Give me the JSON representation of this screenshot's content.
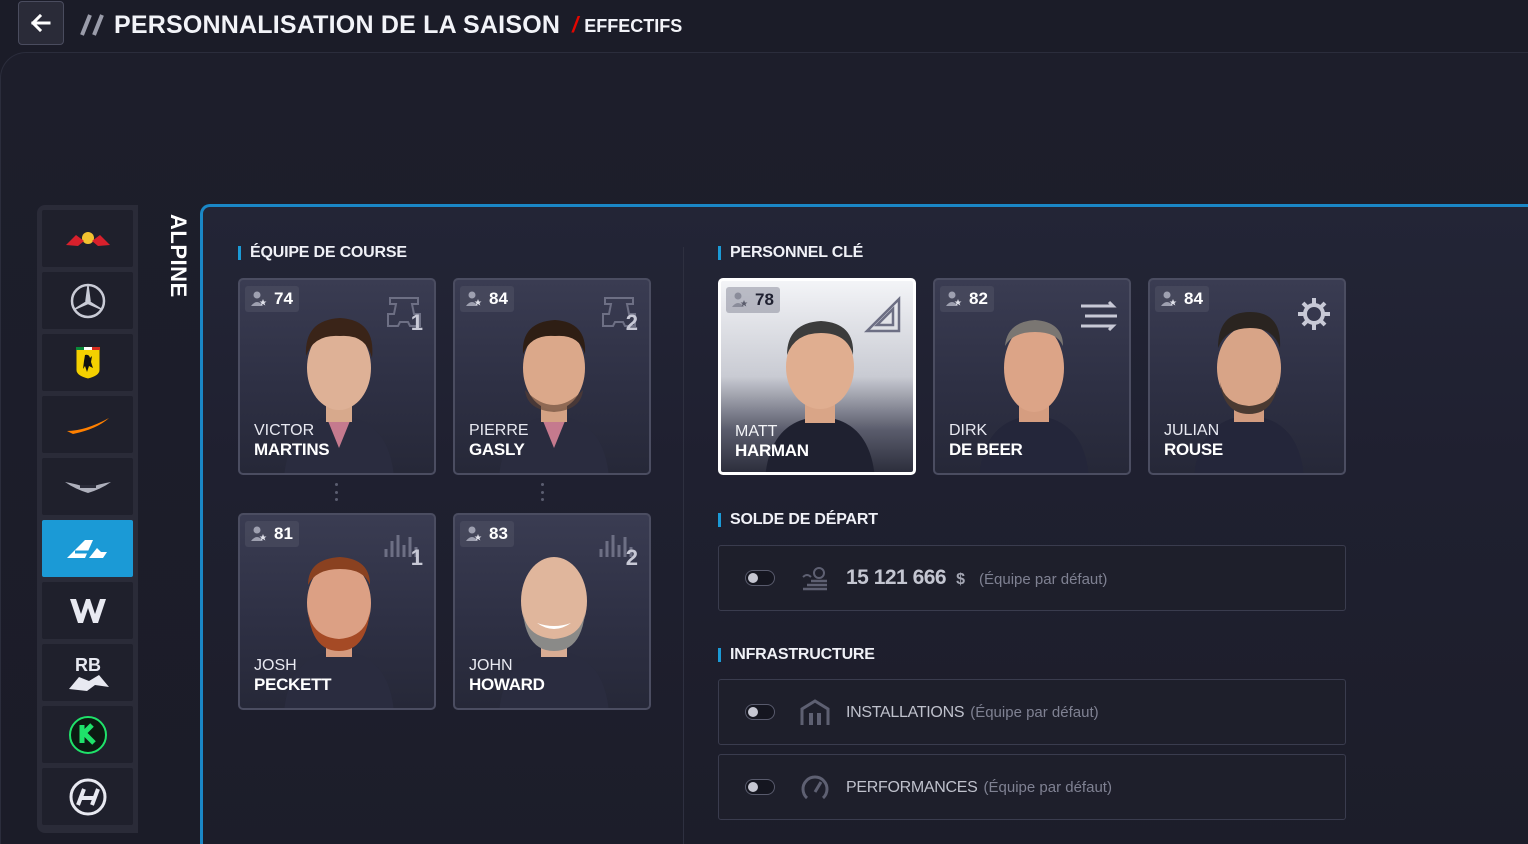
{
  "header": {
    "title": "PERSONNALISATION DE LA SAISON",
    "subtitle": "EFFECTIFS"
  },
  "sidebar": {
    "selected_team": "ALPINE",
    "teams": [
      {
        "name": "red-bull",
        "icon": "red-bull-logo"
      },
      {
        "name": "mercedes",
        "icon": "mercedes-logo"
      },
      {
        "name": "ferrari",
        "icon": "ferrari-logo"
      },
      {
        "name": "mclaren",
        "icon": "mclaren-logo"
      },
      {
        "name": "aston-martin",
        "icon": "aston-martin-logo"
      },
      {
        "name": "alpine",
        "icon": "alpine-logo",
        "active": true
      },
      {
        "name": "williams",
        "icon": "williams-logo",
        "label": "W"
      },
      {
        "name": "racing-bulls",
        "icon": "racing-bulls-logo",
        "label": "RB"
      },
      {
        "name": "sauber",
        "icon": "sauber-logo",
        "label": "K"
      },
      {
        "name": "haas",
        "icon": "haas-logo"
      }
    ]
  },
  "race_team": {
    "title": "ÉQUIPE DE COURSE",
    "members": [
      {
        "rating": "74",
        "first": "VICTOR",
        "last": "MARTINS",
        "role_icon": "race-car-icon",
        "number": "1"
      },
      {
        "rating": "84",
        "first": "PIERRE",
        "last": "GASLY",
        "role_icon": "race-car-icon",
        "number": "2"
      },
      {
        "rating": "81",
        "first": "JOSH",
        "last": "PECKETT",
        "role_icon": "engineer-signal-icon",
        "number": "1"
      },
      {
        "rating": "83",
        "first": "JOHN",
        "last": "HOWARD",
        "role_icon": "engineer-signal-icon",
        "number": "2"
      }
    ]
  },
  "key_staff": {
    "title": "PERSONNEL CLÉ",
    "members": [
      {
        "rating": "78",
        "first": "MATT",
        "last": "HARMAN",
        "role_icon": "set-square-icon",
        "selected": true
      },
      {
        "rating": "82",
        "first": "DIRK",
        "last": "DE BEER",
        "role_icon": "aero-flow-icon"
      },
      {
        "rating": "84",
        "first": "JULIAN",
        "last": "ROUSE",
        "role_icon": "gear-icon"
      }
    ]
  },
  "balance": {
    "title": "SOLDE DE DÉPART",
    "amount": "15 121 666",
    "unit": "$",
    "note": "(Équipe par défaut)"
  },
  "infrastructure": {
    "title": "INFRASTRUCTURE",
    "items": [
      {
        "label": "INSTALLATIONS",
        "note": "(Équipe par défaut)",
        "icon": "building-icon"
      },
      {
        "label": "PERFORMANCES",
        "note": "(Équipe par défaut)",
        "icon": "speedometer-icon"
      }
    ]
  },
  "colors": {
    "accent": "#1b9ad6",
    "background": "#1b1c28",
    "header_slash": "#e10600"
  }
}
